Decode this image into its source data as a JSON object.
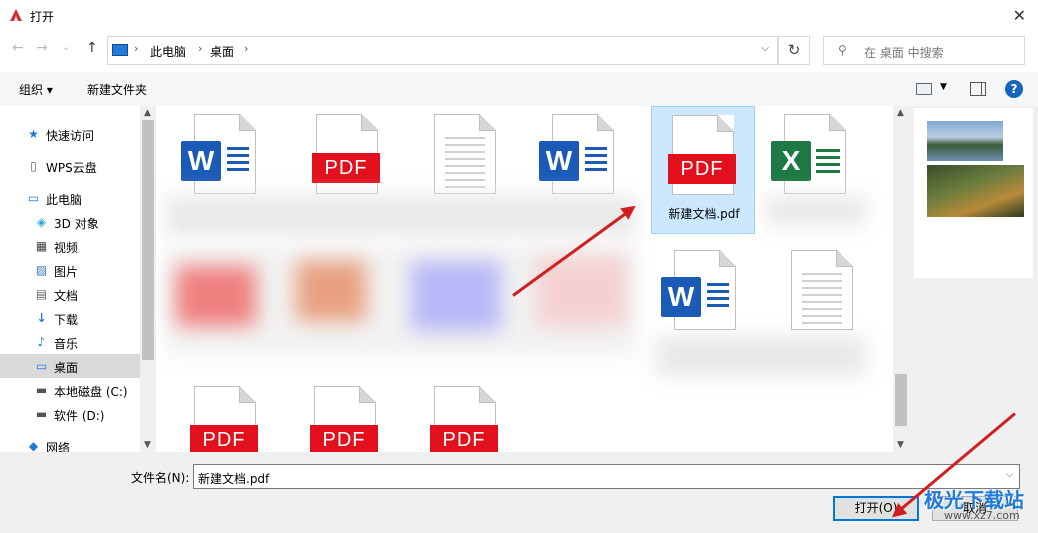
{
  "window": {
    "title": "打开"
  },
  "nav": {
    "back": "←",
    "forward": "→",
    "history": "⌄",
    "up": "↑",
    "breadcrumb": [
      "此电脑",
      "桌面"
    ],
    "refresh": "↻",
    "search_placeholder": "在 桌面 中搜索"
  },
  "toolbar": {
    "organize": "组织 ▾",
    "new_folder": "新建文件夹",
    "help": "?"
  },
  "sidebar": {
    "items": [
      {
        "label": "快速访问",
        "icon": "★"
      },
      {
        "label": "WPS云盘",
        "icon": "▯"
      },
      {
        "label": "此电脑",
        "icon": "▭"
      },
      {
        "label": "3D 对象",
        "icon": "◈"
      },
      {
        "label": "视频",
        "icon": "▦"
      },
      {
        "label": "图片",
        "icon": "▨"
      },
      {
        "label": "文档",
        "icon": "▤"
      },
      {
        "label": "下载",
        "icon": "↓"
      },
      {
        "label": "音乐",
        "icon": "♪"
      },
      {
        "label": "桌面",
        "icon": "▭"
      },
      {
        "label": "本地磁盘 (C:)",
        "icon": "▬"
      },
      {
        "label": "软件 (D:)",
        "icon": "▬"
      },
      {
        "label": "网络",
        "icon": "◆"
      }
    ]
  },
  "files": {
    "selected_name": "新建文档.pdf",
    "badges": {
      "pdf": "PDF",
      "word": "W",
      "excel": "X"
    }
  },
  "bottom": {
    "filename_label": "文件名(N):",
    "filename_value": "新建文档.pdf",
    "open_label": "打开(O)",
    "cancel_label": "取消"
  },
  "watermark": {
    "text": "极光下载站",
    "url": "www.xz7.com"
  },
  "colors": {
    "pdf": "#e2101c",
    "word": "#1b5bb8",
    "excel": "#1d7a45",
    "arrow": "#d11f1f",
    "selection": "#cce8ff"
  }
}
